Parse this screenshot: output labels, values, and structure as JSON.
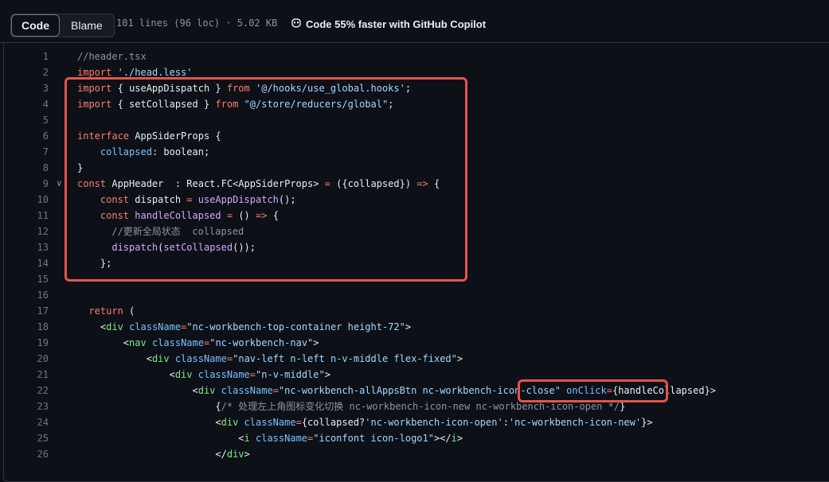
{
  "toolbar": {
    "tabs": [
      {
        "label": "Code",
        "active": true
      },
      {
        "label": "Blame",
        "active": false
      }
    ],
    "stats": "101 lines (96 loc) · 5.02 KB",
    "copilot_label": "Code 55% faster with GitHub Copilot"
  },
  "colors": {
    "keyword": "#ff7b72",
    "string": "#a5d6ff",
    "comment": "#8b949e",
    "function": "#d2a8ff",
    "tag": "#7ee787",
    "attribute": "#79c0ff",
    "annotation": "#e5534b",
    "background": "#0d1117"
  },
  "code_lines": [
    {
      "num": "1",
      "indent": "",
      "tokens": [
        [
          "cm",
          "//header.tsx"
        ]
      ]
    },
    {
      "num": "2",
      "indent": "",
      "tokens": [
        [
          "kw",
          "import"
        ],
        [
          "pl",
          " "
        ],
        [
          "str",
          "'./head.less'"
        ]
      ]
    },
    {
      "num": "3",
      "indent": "",
      "tokens": [
        [
          "kw",
          "import"
        ],
        [
          "pl",
          " { useAppDispatch } "
        ],
        [
          "kw",
          "from"
        ],
        [
          "pl",
          " "
        ],
        [
          "str",
          "'@/hooks/use_global.hooks'"
        ],
        [
          "pl",
          ";"
        ]
      ]
    },
    {
      "num": "4",
      "indent": "",
      "tokens": [
        [
          "kw",
          "import"
        ],
        [
          "pl",
          " { setCollapsed } "
        ],
        [
          "kw",
          "from"
        ],
        [
          "pl",
          " "
        ],
        [
          "str",
          "\"@/store/reducers/global\""
        ],
        [
          "pl",
          ";"
        ]
      ]
    },
    {
      "num": "5",
      "indent": "",
      "tokens": []
    },
    {
      "num": "6",
      "indent": "",
      "tokens": [
        [
          "kw",
          "interface"
        ],
        [
          "pl",
          " AppSiderProps {"
        ]
      ]
    },
    {
      "num": "7",
      "indent": "    ",
      "tokens": [
        [
          "ent",
          "collapsed"
        ],
        [
          "pl",
          ": boolean;"
        ]
      ]
    },
    {
      "num": "8",
      "indent": "",
      "tokens": [
        [
          "pl",
          "}"
        ]
      ]
    },
    {
      "num": "9",
      "indent": "",
      "fold": true,
      "tokens": [
        [
          "kw",
          "const"
        ],
        [
          "pl",
          " AppHeader  : React.FC<AppSiderProps> "
        ],
        [
          "kw",
          "="
        ],
        [
          "pl",
          " ({collapsed}) "
        ],
        [
          "kw",
          "=>"
        ],
        [
          "pl",
          " {"
        ]
      ]
    },
    {
      "num": "10",
      "indent": "    ",
      "tokens": [
        [
          "kw",
          "const"
        ],
        [
          "pl",
          " dispatch "
        ],
        [
          "kw",
          "="
        ],
        [
          "pl",
          " "
        ],
        [
          "fn",
          "useAppDispatch"
        ],
        [
          "pl",
          "();"
        ]
      ]
    },
    {
      "num": "11",
      "indent": "    ",
      "tokens": [
        [
          "kw",
          "const"
        ],
        [
          "pl",
          " "
        ],
        [
          "fn",
          "handleCollapsed"
        ],
        [
          "pl",
          " "
        ],
        [
          "kw",
          "="
        ],
        [
          "pl",
          " () "
        ],
        [
          "kw",
          "=>"
        ],
        [
          "pl",
          " {"
        ]
      ]
    },
    {
      "num": "12",
      "indent": "      ",
      "tokens": [
        [
          "cm",
          "//更新全局状态  collapsed"
        ]
      ]
    },
    {
      "num": "13",
      "indent": "      ",
      "tokens": [
        [
          "fn",
          "dispatch"
        ],
        [
          "pl",
          "("
        ],
        [
          "fn",
          "setCollapsed"
        ],
        [
          "pl",
          "());"
        ]
      ]
    },
    {
      "num": "14",
      "indent": "    ",
      "tokens": [
        [
          "pl",
          "};"
        ]
      ]
    },
    {
      "num": "15",
      "indent": "",
      "tokens": []
    },
    {
      "num": "16",
      "indent": "",
      "tokens": []
    },
    {
      "num": "17",
      "indent": "  ",
      "tokens": [
        [
          "kw",
          "return"
        ],
        [
          "pl",
          " ("
        ]
      ]
    },
    {
      "num": "18",
      "indent": "    ",
      "tokens": [
        [
          "pl",
          "<"
        ],
        [
          "tag",
          "div"
        ],
        [
          "pl",
          " "
        ],
        [
          "attr",
          "className"
        ],
        [
          "kw",
          "="
        ],
        [
          "str",
          "\"nc-workbench-top-container height-72\""
        ],
        [
          "pl",
          ">"
        ]
      ]
    },
    {
      "num": "19",
      "indent": "        ",
      "tokens": [
        [
          "pl",
          "<"
        ],
        [
          "tag",
          "nav"
        ],
        [
          "pl",
          " "
        ],
        [
          "attr",
          "className"
        ],
        [
          "kw",
          "="
        ],
        [
          "str",
          "\"nc-workbench-nav\""
        ],
        [
          "pl",
          ">"
        ]
      ]
    },
    {
      "num": "20",
      "indent": "            ",
      "tokens": [
        [
          "pl",
          "<"
        ],
        [
          "tag",
          "div"
        ],
        [
          "pl",
          " "
        ],
        [
          "attr",
          "className"
        ],
        [
          "kw",
          "="
        ],
        [
          "str",
          "\"nav-left n-left n-v-middle flex-fixed\""
        ],
        [
          "pl",
          ">"
        ]
      ]
    },
    {
      "num": "21",
      "indent": "                ",
      "tokens": [
        [
          "pl",
          "<"
        ],
        [
          "tag",
          "div"
        ],
        [
          "pl",
          " "
        ],
        [
          "attr",
          "className"
        ],
        [
          "kw",
          "="
        ],
        [
          "str",
          "\"n-v-middle\""
        ],
        [
          "pl",
          ">"
        ]
      ]
    },
    {
      "num": "22",
      "indent": "                    ",
      "tokens": [
        [
          "pl",
          "<"
        ],
        [
          "tag",
          "div"
        ],
        [
          "pl",
          " "
        ],
        [
          "attr",
          "className"
        ],
        [
          "kw",
          "="
        ],
        [
          "str",
          "\"nc-workbench-allAppsBtn nc-workbench-icon-close\""
        ],
        [
          "pl",
          " "
        ],
        [
          "attr",
          "onClick"
        ],
        [
          "kw",
          "="
        ],
        [
          "pl",
          "{handleCollapsed}>"
        ]
      ]
    },
    {
      "num": "23",
      "indent": "                        ",
      "tokens": [
        [
          "pl",
          "{"
        ],
        [
          "cm",
          "/* 处理左上角图标变化切换 nc-workbench-icon-new nc-workbench-icon-open */"
        ],
        [
          "pl",
          "}"
        ]
      ]
    },
    {
      "num": "24",
      "indent": "                        ",
      "tokens": [
        [
          "pl",
          "<"
        ],
        [
          "tag",
          "div"
        ],
        [
          "pl",
          " "
        ],
        [
          "attr",
          "className"
        ],
        [
          "kw",
          "="
        ],
        [
          "pl",
          "{collapsed?"
        ],
        [
          "str",
          "'nc-workbench-icon-open'"
        ],
        [
          "pl",
          ":"
        ],
        [
          "str",
          "'nc-workbench-icon-new'"
        ],
        [
          "pl",
          "}>"
        ]
      ]
    },
    {
      "num": "25",
      "indent": "                            ",
      "tokens": [
        [
          "pl",
          "<"
        ],
        [
          "tag",
          "i"
        ],
        [
          "pl",
          " "
        ],
        [
          "attr",
          "className"
        ],
        [
          "kw",
          "="
        ],
        [
          "str",
          "\"iconfont icon-logo1\""
        ],
        [
          "pl",
          "></"
        ],
        [
          "tag",
          "i"
        ],
        [
          "pl",
          ">"
        ]
      ]
    },
    {
      "num": "26",
      "indent": "                        ",
      "tokens": [
        [
          "pl",
          "</"
        ],
        [
          "tag",
          "div"
        ],
        [
          "pl",
          ">"
        ]
      ]
    }
  ]
}
